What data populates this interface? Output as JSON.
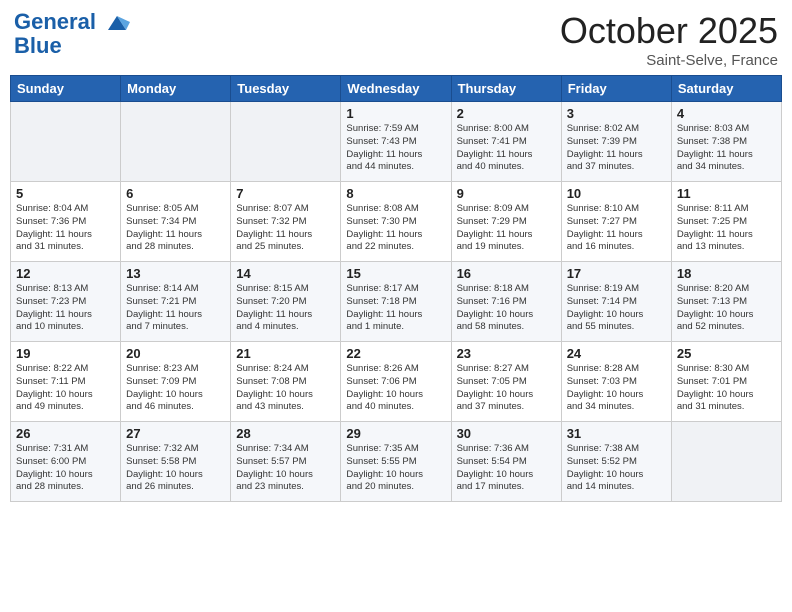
{
  "header": {
    "logo_line1": "General",
    "logo_line2": "Blue",
    "month": "October 2025",
    "location": "Saint-Selve, France"
  },
  "weekdays": [
    "Sunday",
    "Monday",
    "Tuesday",
    "Wednesday",
    "Thursday",
    "Friday",
    "Saturday"
  ],
  "weeks": [
    [
      {
        "day": "",
        "info": ""
      },
      {
        "day": "",
        "info": ""
      },
      {
        "day": "",
        "info": ""
      },
      {
        "day": "1",
        "info": "Sunrise: 7:59 AM\nSunset: 7:43 PM\nDaylight: 11 hours\nand 44 minutes."
      },
      {
        "day": "2",
        "info": "Sunrise: 8:00 AM\nSunset: 7:41 PM\nDaylight: 11 hours\nand 40 minutes."
      },
      {
        "day": "3",
        "info": "Sunrise: 8:02 AM\nSunset: 7:39 PM\nDaylight: 11 hours\nand 37 minutes."
      },
      {
        "day": "4",
        "info": "Sunrise: 8:03 AM\nSunset: 7:38 PM\nDaylight: 11 hours\nand 34 minutes."
      }
    ],
    [
      {
        "day": "5",
        "info": "Sunrise: 8:04 AM\nSunset: 7:36 PM\nDaylight: 11 hours\nand 31 minutes."
      },
      {
        "day": "6",
        "info": "Sunrise: 8:05 AM\nSunset: 7:34 PM\nDaylight: 11 hours\nand 28 minutes."
      },
      {
        "day": "7",
        "info": "Sunrise: 8:07 AM\nSunset: 7:32 PM\nDaylight: 11 hours\nand 25 minutes."
      },
      {
        "day": "8",
        "info": "Sunrise: 8:08 AM\nSunset: 7:30 PM\nDaylight: 11 hours\nand 22 minutes."
      },
      {
        "day": "9",
        "info": "Sunrise: 8:09 AM\nSunset: 7:29 PM\nDaylight: 11 hours\nand 19 minutes."
      },
      {
        "day": "10",
        "info": "Sunrise: 8:10 AM\nSunset: 7:27 PM\nDaylight: 11 hours\nand 16 minutes."
      },
      {
        "day": "11",
        "info": "Sunrise: 8:11 AM\nSunset: 7:25 PM\nDaylight: 11 hours\nand 13 minutes."
      }
    ],
    [
      {
        "day": "12",
        "info": "Sunrise: 8:13 AM\nSunset: 7:23 PM\nDaylight: 11 hours\nand 10 minutes."
      },
      {
        "day": "13",
        "info": "Sunrise: 8:14 AM\nSunset: 7:21 PM\nDaylight: 11 hours\nand 7 minutes."
      },
      {
        "day": "14",
        "info": "Sunrise: 8:15 AM\nSunset: 7:20 PM\nDaylight: 11 hours\nand 4 minutes."
      },
      {
        "day": "15",
        "info": "Sunrise: 8:17 AM\nSunset: 7:18 PM\nDaylight: 11 hours\nand 1 minute."
      },
      {
        "day": "16",
        "info": "Sunrise: 8:18 AM\nSunset: 7:16 PM\nDaylight: 10 hours\nand 58 minutes."
      },
      {
        "day": "17",
        "info": "Sunrise: 8:19 AM\nSunset: 7:14 PM\nDaylight: 10 hours\nand 55 minutes."
      },
      {
        "day": "18",
        "info": "Sunrise: 8:20 AM\nSunset: 7:13 PM\nDaylight: 10 hours\nand 52 minutes."
      }
    ],
    [
      {
        "day": "19",
        "info": "Sunrise: 8:22 AM\nSunset: 7:11 PM\nDaylight: 10 hours\nand 49 minutes."
      },
      {
        "day": "20",
        "info": "Sunrise: 8:23 AM\nSunset: 7:09 PM\nDaylight: 10 hours\nand 46 minutes."
      },
      {
        "day": "21",
        "info": "Sunrise: 8:24 AM\nSunset: 7:08 PM\nDaylight: 10 hours\nand 43 minutes."
      },
      {
        "day": "22",
        "info": "Sunrise: 8:26 AM\nSunset: 7:06 PM\nDaylight: 10 hours\nand 40 minutes."
      },
      {
        "day": "23",
        "info": "Sunrise: 8:27 AM\nSunset: 7:05 PM\nDaylight: 10 hours\nand 37 minutes."
      },
      {
        "day": "24",
        "info": "Sunrise: 8:28 AM\nSunset: 7:03 PM\nDaylight: 10 hours\nand 34 minutes."
      },
      {
        "day": "25",
        "info": "Sunrise: 8:30 AM\nSunset: 7:01 PM\nDaylight: 10 hours\nand 31 minutes."
      }
    ],
    [
      {
        "day": "26",
        "info": "Sunrise: 7:31 AM\nSunset: 6:00 PM\nDaylight: 10 hours\nand 28 minutes."
      },
      {
        "day": "27",
        "info": "Sunrise: 7:32 AM\nSunset: 5:58 PM\nDaylight: 10 hours\nand 26 minutes."
      },
      {
        "day": "28",
        "info": "Sunrise: 7:34 AM\nSunset: 5:57 PM\nDaylight: 10 hours\nand 23 minutes."
      },
      {
        "day": "29",
        "info": "Sunrise: 7:35 AM\nSunset: 5:55 PM\nDaylight: 10 hours\nand 20 minutes."
      },
      {
        "day": "30",
        "info": "Sunrise: 7:36 AM\nSunset: 5:54 PM\nDaylight: 10 hours\nand 17 minutes."
      },
      {
        "day": "31",
        "info": "Sunrise: 7:38 AM\nSunset: 5:52 PM\nDaylight: 10 hours\nand 14 minutes."
      },
      {
        "day": "",
        "info": ""
      }
    ]
  ]
}
